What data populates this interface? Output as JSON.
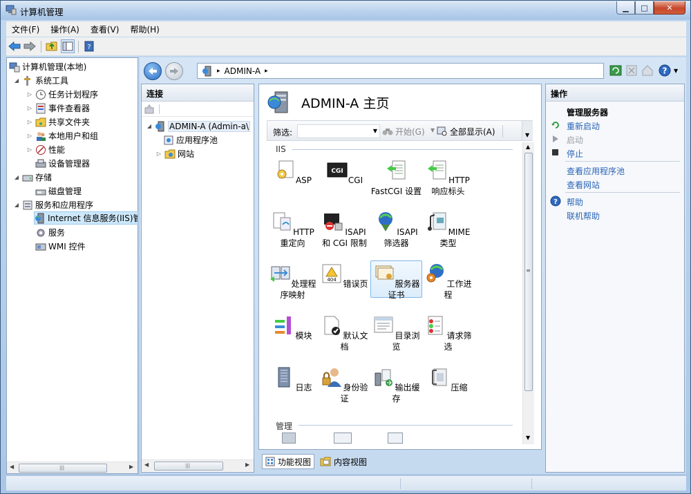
{
  "window": {
    "title": "计算机管理",
    "minimize": "▁",
    "maximize": "□",
    "close": "✕"
  },
  "menu": [
    "文件(F)",
    "操作(A)",
    "查看(V)",
    "帮助(H)"
  ],
  "tree": {
    "root": "计算机管理(本地)",
    "system_tools": "系统工具",
    "system_children": [
      "任务计划程序",
      "事件查看器",
      "共享文件夹",
      "本地用户和组",
      "性能",
      "设备管理器"
    ],
    "storage": "存储",
    "storage_children": [
      "磁盘管理"
    ],
    "services_apps": "服务和应用程序",
    "services_children": [
      "Internet 信息服务(IIS)管",
      "服务",
      "WMI 控件"
    ]
  },
  "address": {
    "segment": "ADMIN-A",
    "arrow1": "▸",
    "arrow2": "▸"
  },
  "connections": {
    "header": "连接",
    "server": "ADMIN-A (Admin-a\\",
    "children": [
      "应用程序池",
      "网站"
    ]
  },
  "home": {
    "title": "ADMIN-A 主页",
    "filter_label": "筛选:",
    "start_label": "开始(G)",
    "showall_label": "全部显示(A)",
    "section_iis": "IIS",
    "section_manage": "管理",
    "features": [
      {
        "label": "ASP",
        "icon": "asp-icon"
      },
      {
        "label": "CGI",
        "icon": "cgi-icon"
      },
      {
        "label": "FastCGI 设置",
        "icon": "fastcgi-icon"
      },
      {
        "label": "HTTP 响应标头",
        "icon": "http-response-headers-icon"
      },
      {
        "label": "HTTP 重定向",
        "icon": "http-redirect-icon"
      },
      {
        "label": "ISAPI 和 CGI 限制",
        "icon": "isapi-cgi-restrictions-icon"
      },
      {
        "label": "ISAPI 筛选器",
        "icon": "isapi-filters-icon"
      },
      {
        "label": "MIME 类型",
        "icon": "mime-types-icon"
      },
      {
        "label": "处理程序映射",
        "icon": "handler-mappings-icon"
      },
      {
        "label": "错误页",
        "icon": "error-pages-icon"
      },
      {
        "label": "服务器证书",
        "icon": "server-certificates-icon"
      },
      {
        "label": "工作进程",
        "icon": "worker-processes-icon"
      },
      {
        "label": "模块",
        "icon": "modules-icon"
      },
      {
        "label": "默认文档",
        "icon": "default-document-icon"
      },
      {
        "label": "目录浏览",
        "icon": "directory-browsing-icon"
      },
      {
        "label": "请求筛选",
        "icon": "request-filtering-icon"
      },
      {
        "label": "日志",
        "icon": "logging-icon"
      },
      {
        "label": "身份验证",
        "icon": "authentication-icon"
      },
      {
        "label": "输出缓存",
        "icon": "output-caching-icon"
      },
      {
        "label": "压缩",
        "icon": "compression-icon"
      }
    ],
    "view_tabs": [
      "功能视图",
      "内容视图"
    ]
  },
  "actions": {
    "header": "操作",
    "group": "管理服务器",
    "restart": "重新启动",
    "start": "启动",
    "stop": "停止",
    "view_pools": "查看应用程序池",
    "view_sites": "查看网站",
    "help": "帮助",
    "online_help": "联机帮助"
  },
  "colors": {
    "link": "#2a64b6",
    "selection": "#cde8fa",
    "accent": "#3b6fb6"
  }
}
